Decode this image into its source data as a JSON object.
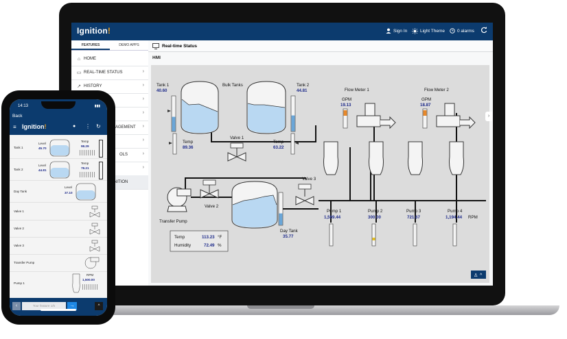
{
  "app": {
    "logo_text": "Ignition",
    "logo_mark": "!",
    "topbar": {
      "sign_in": "Sign In",
      "theme": "Light Theme",
      "alarms": "0 alarms"
    }
  },
  "sidebar": {
    "tabs": [
      "FEATURES",
      "DEMO APPS"
    ],
    "items": [
      {
        "label": "HOME",
        "icon": "home-icon"
      },
      {
        "label": "REAL-TIME STATUS",
        "icon": "monitor-icon"
      },
      {
        "label": "HISTORY",
        "icon": "trend-icon"
      },
      {
        "label": "",
        "icon": ""
      },
      {
        "label": "",
        "icon": ""
      },
      {
        "label": "AGEMENT",
        "icon": ""
      },
      {
        "label": "",
        "icon": ""
      },
      {
        "label": "OLS",
        "icon": ""
      },
      {
        "label": "",
        "icon": ""
      },
      {
        "label": "NITION",
        "icon": ""
      }
    ]
  },
  "page": {
    "title": "Real-time Status",
    "section": "HMI"
  },
  "hmi": {
    "bulk_tanks": "Bulk Tanks",
    "tank1": {
      "name": "Tank 1",
      "value": "40.60",
      "level": 0.41
    },
    "tank2": {
      "name": "Tank 2",
      "value": "44.81",
      "level": 0.45
    },
    "temp1": {
      "name": "Temp",
      "value": "89.36"
    },
    "temp2": {
      "name": "Temp",
      "value": "63.22"
    },
    "valve1": "Valve 1",
    "valve2": "Valve 2",
    "valve3": "Valve 3",
    "transfer_pump": "Transfer Pump",
    "day_tank": {
      "name": "Day Tank",
      "value": "35.77",
      "level": 0.36
    },
    "flow_meter1": {
      "name": "Flow Meter 1",
      "gpm_label": "GPM",
      "value": "19.13"
    },
    "flow_meter2": {
      "name": "Flow Meter 2",
      "gpm_label": "GPM",
      "value": "18.87"
    },
    "pumps": [
      {
        "name": "Pump 1",
        "value": "1,569.44"
      },
      {
        "name": "Pump 2",
        "value": "300.00"
      },
      {
        "name": "Pump 3",
        "value": "721.67"
      },
      {
        "name": "Pump 4",
        "value": "1,194.44"
      }
    ],
    "rpm_unit": "RPM",
    "env": {
      "temp_label": "Temp",
      "temp_value": "113.23",
      "temp_unit": "°F",
      "humidity_label": "Humidity",
      "humidity_value": "72.49",
      "humidity_unit": "%"
    }
  },
  "phone": {
    "time": "14:13",
    "back": "Back",
    "logo_text": "Ignition",
    "tank1": {
      "name": "Tank 1",
      "level_label": "Level",
      "level": "45.70",
      "temp_label": "Temp",
      "temp": "98.29"
    },
    "tank2": {
      "name": "Tank 2",
      "level_label": "Level",
      "level": "44.81",
      "temp_label": "Temp",
      "temp": "78.21"
    },
    "day_tank": {
      "name": "Day Tank",
      "level_label": "Level",
      "level": "37.10"
    },
    "valve1": "Valve 1",
    "valve2": "Valve 2",
    "valve3": "Valve 3",
    "transfer_pump": "Transfer Pump",
    "pump1": {
      "name": "Pump 1",
      "rpm_label": "RPM",
      "rpm": "1,500.00"
    },
    "tour": "Tour feature 1/5"
  },
  "colors": {
    "brand_navy": "#0c3b6e",
    "accent_orange": "#f7a21b",
    "liquid": "#b9d8f2",
    "value_text": "#1d2a8a"
  }
}
